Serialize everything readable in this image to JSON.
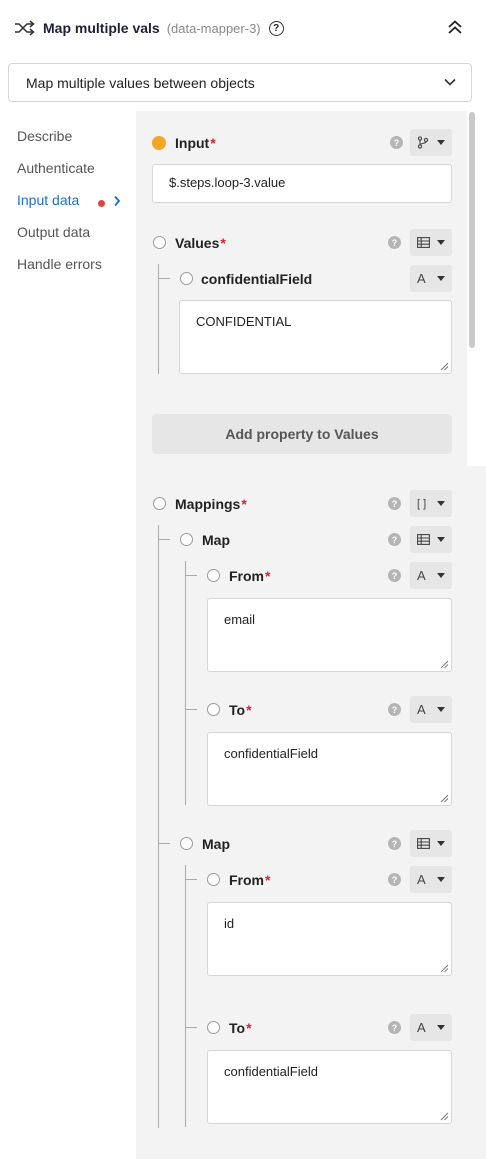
{
  "header": {
    "title": "Map multiple vals",
    "slug": "(data-mapper-3)",
    "help_glyph": "?"
  },
  "action_select": {
    "value": "Map multiple values between objects"
  },
  "sidebar": {
    "items": [
      {
        "label": "Describe"
      },
      {
        "label": "Authenticate"
      },
      {
        "label": "Input data"
      },
      {
        "label": "Output data"
      },
      {
        "label": "Handle errors"
      }
    ],
    "active_index": 2
  },
  "form": {
    "input": {
      "label": "Input",
      "required": "*",
      "value": "$.steps.loop-3.value"
    },
    "values": {
      "label": "Values",
      "required": "*",
      "property": {
        "label": "confidentialField",
        "value": "CONFIDENTIAL"
      },
      "add_button": "Add property to Values"
    },
    "mappings": {
      "label": "Mappings",
      "required": "*",
      "type_glyph": "[ ]",
      "maps": [
        {
          "label": "Map",
          "from_label": "From",
          "from_value": "email",
          "to_label": "To",
          "to_value": "confidentialField"
        },
        {
          "label": "Map",
          "from_label": "From",
          "from_value": "id",
          "to_label": "To",
          "to_value": "confidentialField"
        }
      ]
    },
    "text_type_glyph": "A",
    "help_glyph": "?"
  },
  "colors": {
    "accent": "#1a6fce",
    "required": "#d5222f",
    "active_dot": "#f5a623",
    "nav_dot": "#e0453a"
  }
}
